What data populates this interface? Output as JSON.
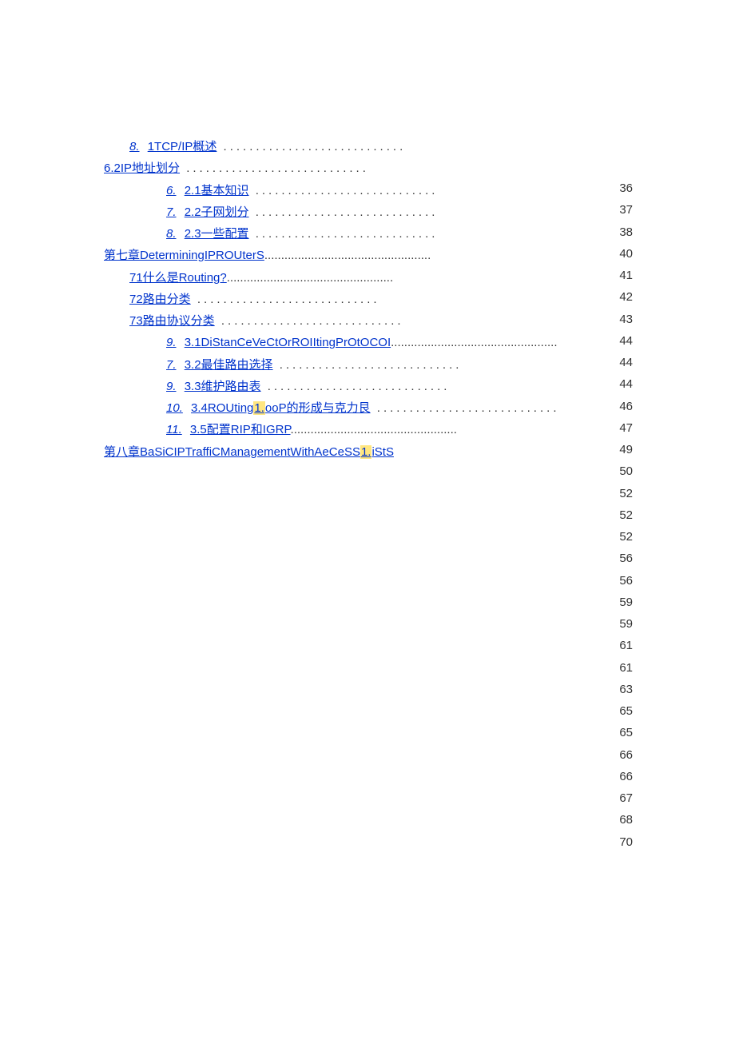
{
  "toc": [
    {
      "level": 1,
      "num": "8.",
      "text": "1TCP/IP概述",
      "dots": "s",
      "hl": false
    },
    {
      "level": 0,
      "num": "",
      "text": "6.2IP地址划分",
      "dots": "s",
      "hl": false
    },
    {
      "level": 2,
      "num": "6.",
      "text": "2.1基本知识",
      "dots": "s",
      "hl": false
    },
    {
      "level": 2,
      "num": "7.",
      "text": "2.2子网划分",
      "dots": "s",
      "hl": false
    },
    {
      "level": 2,
      "num": "8.",
      "text": "2.3一些配置",
      "dots": "s",
      "hl": false
    },
    {
      "level": 0,
      "num": "",
      "text": "第七章DeterminingIPROUterS",
      "dots": "t",
      "hl": false
    },
    {
      "level": 1,
      "num": "",
      "text": "71什么是Routing?",
      "dots": "t",
      "hl": false
    },
    {
      "level": 1,
      "num": "",
      "text": "72路由分类",
      "dots": "s",
      "hl": false
    },
    {
      "level": 1,
      "num": "",
      "text": "73路由协议分类",
      "dots": "s",
      "hl": false
    },
    {
      "level": 2,
      "num": "9.",
      "text": "3.1DiStanCeVeCtOrROIItingPrOtOCOI",
      "dots": "t",
      "hl": false
    },
    {
      "level": 2,
      "num": "7.",
      "text": "3.2最佳路由选择",
      "dots": "s",
      "hl": false
    },
    {
      "level": 2,
      "num": "9.",
      "text": "3.3维护路由表",
      "dots": "s",
      "hl": false
    },
    {
      "level": 2,
      "num": "10.",
      "text": "3.4ROUting1.ooP的形成与克力艮",
      "dots": "s",
      "hl": true,
      "hlseg": "1."
    },
    {
      "level": 2,
      "num": "11.",
      "text": "3.5配置RIP和IGRP",
      "dots": "t",
      "hl": false
    },
    {
      "level": 0,
      "num": "",
      "text": "第八章BaSiCIPTraffiCManagementWithAeCeSS1.iStS",
      "dots": "",
      "hl": true,
      "hlseg": "1."
    }
  ],
  "page_numbers": [
    "36",
    "37",
    "38",
    "40",
    "41",
    "42",
    "43",
    "44",
    "44",
    "44",
    "46",
    "47",
    "49",
    "50",
    "52",
    "52",
    "52",
    "56",
    "56",
    "59",
    "59",
    "61",
    "61",
    "63",
    "65",
    "65",
    "66",
    "66",
    "67",
    "68",
    "70"
  ]
}
